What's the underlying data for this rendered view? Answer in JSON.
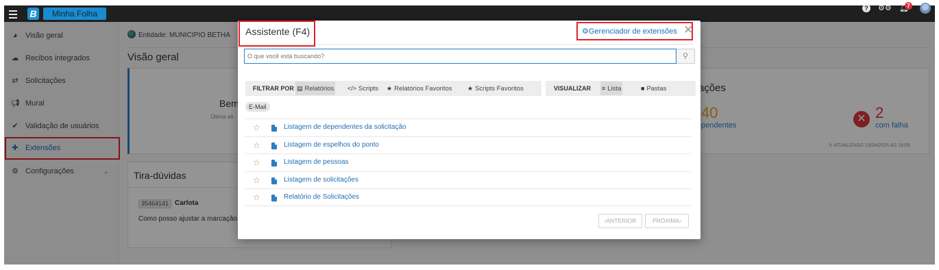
{
  "topbar": {
    "brand_letter": "B",
    "brand_name": "Minha Folha",
    "notification_count": "7",
    "help_glyph": "?"
  },
  "sidebar": {
    "items": [
      {
        "label": "Visão geral",
        "icon": "pie-chart-icon"
      },
      {
        "label": "Recibos integrados",
        "icon": "cloud-icon"
      },
      {
        "label": "Solicitações",
        "icon": "exchange-icon"
      },
      {
        "label": "Mural",
        "icon": "megaphone-icon"
      },
      {
        "label": "Validação de usuários",
        "icon": "check-icon"
      },
      {
        "label": "Extensões",
        "icon": "puzzle-icon",
        "active": true
      },
      {
        "label": "Configurações",
        "icon": "gears-icon",
        "has_submenu": true
      }
    ]
  },
  "main": {
    "entity_text": "Entidade: MUNICIPIO BETHA",
    "page_title": "Visão geral",
    "welcome_text": "Bem",
    "last_access_text": "Última ati",
    "actions": {
      "title": "ações",
      "pending_count": "40",
      "pending_label": "pendentes",
      "failed_count": "2",
      "failed_label": "com falha",
      "updated_text": "ATUALIZADO 15/04/2025 ÀS 16:09"
    },
    "faq": {
      "title": "Tira-dúvidas",
      "badge": "35464141",
      "name": "Carlota",
      "question": "Como posso ajustar a marcação"
    }
  },
  "modal": {
    "title": "Assistente (F4)",
    "extensions_link": "Gerenciador de extensões",
    "search_placeholder": "O que você está buscando?",
    "filter": {
      "label": "FILTRAR POR",
      "options": [
        {
          "label": "Relatórios",
          "icon": "document-icon",
          "selected": true
        },
        {
          "label": "Scripts",
          "icon": "code-icon",
          "selected": false
        },
        {
          "label": "Relatórios Favoritos",
          "icon": "star-icon",
          "selected": false
        },
        {
          "label": "Scripts Favoritos",
          "icon": "star-icon",
          "selected": false
        }
      ]
    },
    "view": {
      "label": "VISUALIZAR",
      "options": [
        {
          "label": "Lista",
          "icon": "list-icon",
          "selected": true
        },
        {
          "label": "Pastas",
          "icon": "folder-icon",
          "selected": false
        }
      ]
    },
    "tag": "E-Mail",
    "items": [
      "Listagem de dependentes da solicitação",
      "Listagem de espelhos do ponto",
      "Listagem de pessoas",
      "Listagem de solicitações",
      "Relatório de Solicitações"
    ],
    "pagination": {
      "previous": "ANTERIOR",
      "next": "PRÓXIMA"
    }
  },
  "colors": {
    "accent": "#1f6fb5",
    "highlight_box": "#e0232a",
    "pending": "#e0a120",
    "failure": "#d9363e"
  }
}
